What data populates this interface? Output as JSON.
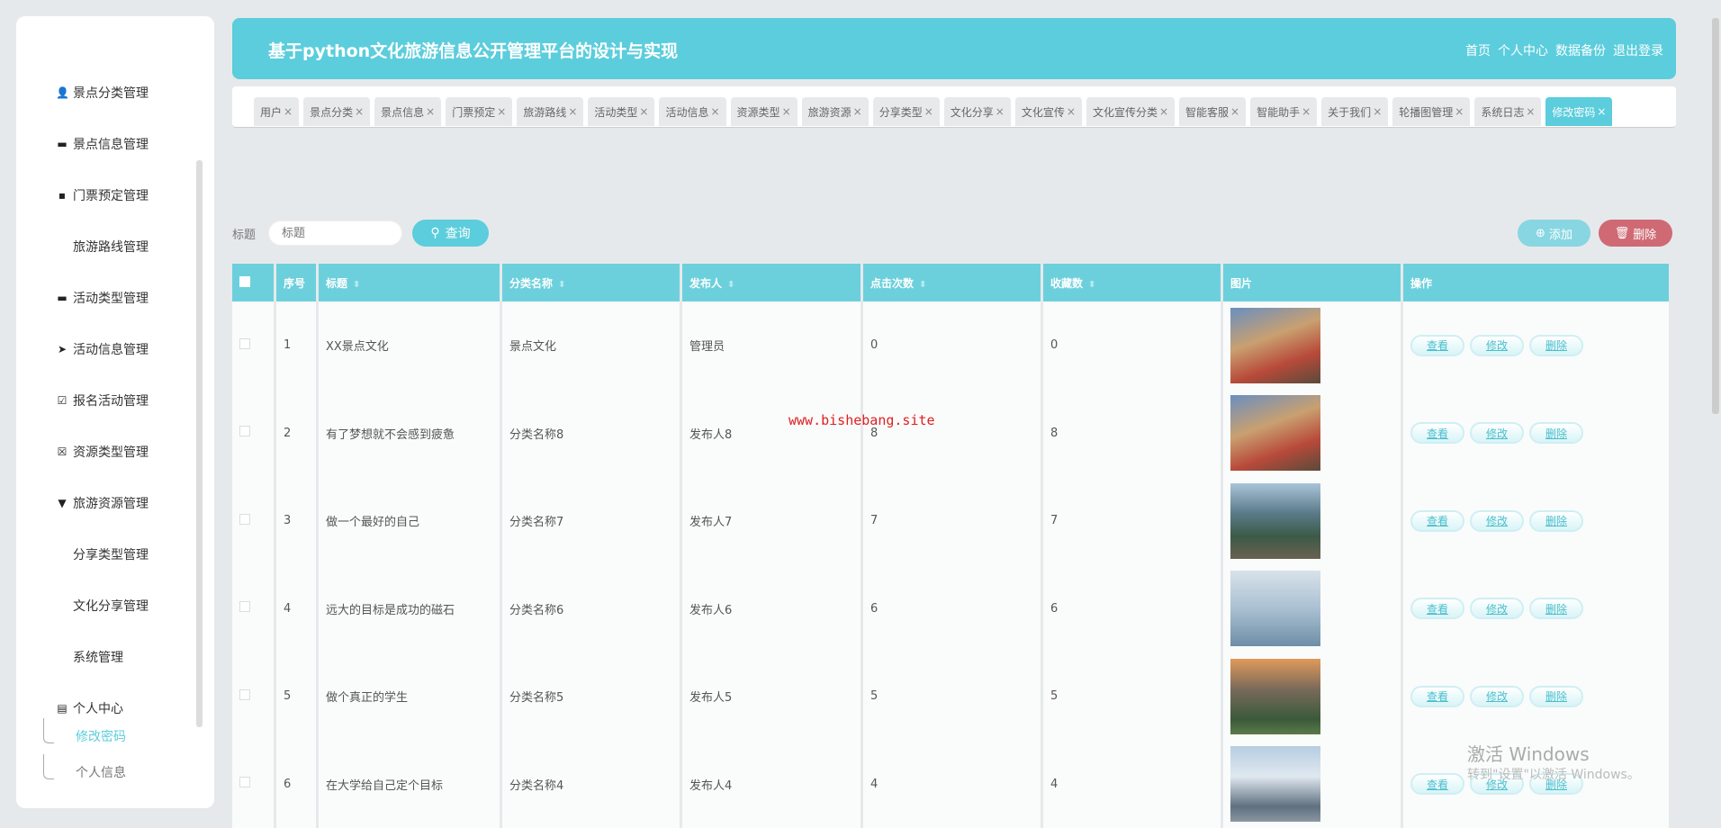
{
  "sidebar": {
    "items": [
      {
        "label": "景点分类管理",
        "icon": "user-icon"
      },
      {
        "label": "景点信息管理",
        "icon": "briefcase-icon"
      },
      {
        "label": "门票预定管理",
        "icon": "message-icon"
      },
      {
        "label": "旅游路线管理",
        "icon": "grid-icon"
      },
      {
        "label": "活动类型管理",
        "icon": "monitor-icon"
      },
      {
        "label": "活动信息管理",
        "icon": "send-icon"
      },
      {
        "label": "报名活动管理",
        "icon": "clipboard-icon"
      },
      {
        "label": "资源类型管理",
        "icon": "close-box-icon"
      },
      {
        "label": "旅游资源管理",
        "icon": "cup-icon"
      },
      {
        "label": "分享类型管理",
        "icon": "grid-icon"
      },
      {
        "label": "文化分享管理",
        "icon": "grid-icon"
      },
      {
        "label": "系统管理",
        "icon": "grid-icon"
      },
      {
        "label": "个人中心",
        "icon": "card-icon"
      }
    ],
    "sub": [
      "修改密码",
      "个人信息"
    ]
  },
  "header": {
    "title": "基于python文化旅游信息公开管理平台的设计与实现",
    "links": [
      "首页",
      "个人中心",
      "数据备份",
      "退出登录"
    ]
  },
  "tabs": [
    "用户",
    "景点分类",
    "景点信息",
    "门票预定",
    "旅游路线",
    "活动类型",
    "活动信息",
    "资源类型",
    "旅游资源",
    "分享类型",
    "文化分享",
    "文化宣传",
    "文化宣传分类",
    "智能客服",
    "智能助手",
    "关于我们",
    "轮播图管理",
    "系统日志",
    "修改密码"
  ],
  "active_tab": "修改密码",
  "search": {
    "label": "标题",
    "placeholder": "标题",
    "button": "查询"
  },
  "actions": {
    "add": "添加",
    "delete": "删除"
  },
  "table": {
    "headers": [
      "序号",
      "标题",
      "分类名称",
      "发布人",
      "点击次数",
      "收藏数",
      "图片",
      "操作"
    ],
    "rows": [
      {
        "no": "1",
        "title": "XX景点文化",
        "cat": "景点文化",
        "pub": "管理员",
        "clicks": "0",
        "fav": "0"
      },
      {
        "no": "2",
        "title": "有了梦想就不会感到疲惫",
        "cat": "分类名称8",
        "pub": "发布人8",
        "clicks": "8",
        "fav": "8"
      },
      {
        "no": "3",
        "title": "做一个最好的自己",
        "cat": "分类名称7",
        "pub": "发布人7",
        "clicks": "7",
        "fav": "7"
      },
      {
        "no": "4",
        "title": "远大的目标是成功的磁石",
        "cat": "分类名称6",
        "pub": "发布人6",
        "clicks": "6",
        "fav": "6"
      },
      {
        "no": "5",
        "title": "做个真正的学生",
        "cat": "分类名称5",
        "pub": "发布人5",
        "clicks": "5",
        "fav": "5"
      },
      {
        "no": "6",
        "title": "在大学给自己定个目标",
        "cat": "分类名称4",
        "pub": "发布人4",
        "clicks": "4",
        "fav": "4"
      }
    ],
    "ops": [
      "查看",
      "修改",
      "删除"
    ]
  },
  "watermark": "www.bishebang.site",
  "windows": {
    "line1": "激活 Windows",
    "line2": "转到\"设置\"以激活 Windows。"
  }
}
